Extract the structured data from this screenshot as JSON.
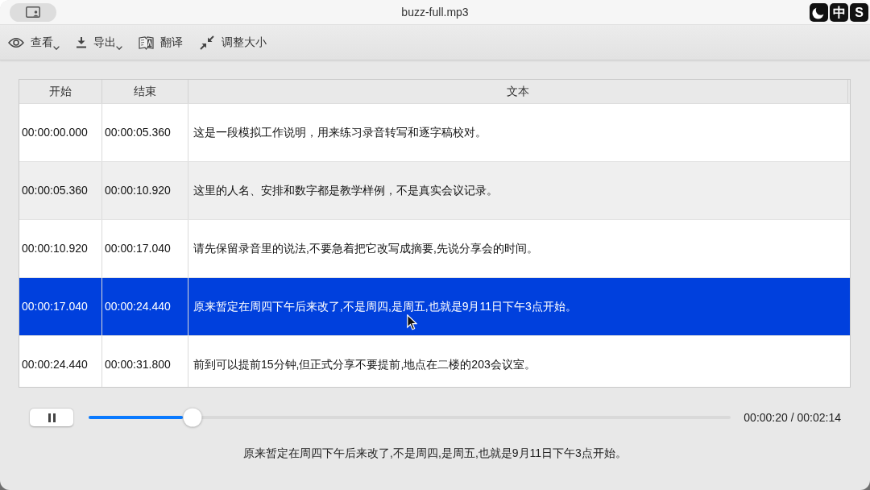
{
  "window": {
    "title": "buzz-full.mp3"
  },
  "ime_bar": [
    {
      "kind": "moon"
    },
    {
      "kind": "label",
      "label": "中"
    },
    {
      "kind": "label",
      "label": "S"
    }
  ],
  "toolbar": [
    {
      "label": "查看",
      "dropdown": true
    },
    {
      "label": "导出",
      "dropdown": true
    },
    {
      "label": "翻译",
      "dropdown": false
    },
    {
      "label": "调整大小",
      "dropdown": false
    }
  ],
  "table": {
    "columns": [
      "开始",
      "结束",
      "文本"
    ],
    "rows": [
      {
        "cells": [
          "00:00:00.000",
          "00:00:05.360",
          "这是一段模拟工作说明，用来练习录音转写和逐字稿校对。"
        ],
        "selected": false
      },
      {
        "cells": [
          "00:00:05.360",
          "00:00:10.920",
          "这里的人名、安排和数字都是教学样例，不是真实会议记录。"
        ],
        "selected": false
      },
      {
        "cells": [
          "00:00:10.920",
          "00:00:17.040",
          "请先保留录音里的说法,不要急着把它改写成摘要,先说分享会的时间。"
        ],
        "selected": false
      },
      {
        "cells": [
          "00:00:17.040",
          "00:00:24.440",
          "原来暂定在周四下午后来改了,不是周四,是周五,也就是9月11日下午3点开始。"
        ],
        "selected": true
      },
      {
        "cells": [
          "00:00:24.440",
          "00:00:31.800",
          "前到可以提前15分钟,但正式分享不要提前,地点在二楼的203会议室。"
        ],
        "selected": false
      }
    ]
  },
  "player": {
    "playing": true,
    "level": 0.162,
    "time": "00:00:20 / 00:02:14"
  },
  "caption": "原来暂定在周四下午后来改了,不是周四,是周五,也就是9月11日下午3点开始。"
}
